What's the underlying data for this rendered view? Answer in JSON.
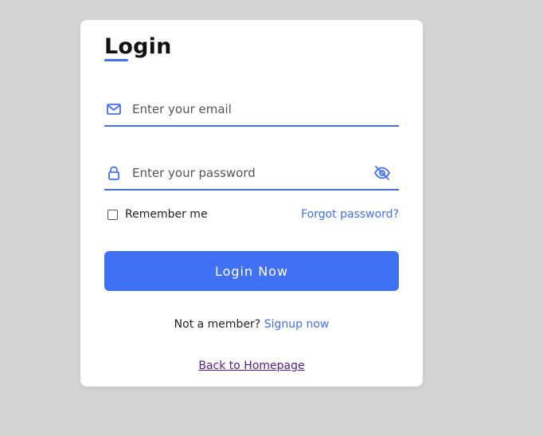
{
  "form": {
    "title": "Login",
    "email": {
      "placeholder": "Enter your email",
      "value": "",
      "icon": "envelope-icon"
    },
    "password": {
      "placeholder": "Enter your password",
      "value": "",
      "icon": "lock-icon",
      "toggle_icon": "eye-slash-icon"
    },
    "remember_label": "Remember me",
    "remember_checked": false,
    "forgot_label": "Forgot password?",
    "submit_label": "Login Now",
    "signup_prompt": "Not a member?",
    "signup_link": "Signup now",
    "back_link": "Back to Homepage"
  },
  "colors": {
    "accent": "#4070f4",
    "background": "#d4d4d4",
    "card": "#ffffff",
    "visited_link": "#551a8b"
  }
}
